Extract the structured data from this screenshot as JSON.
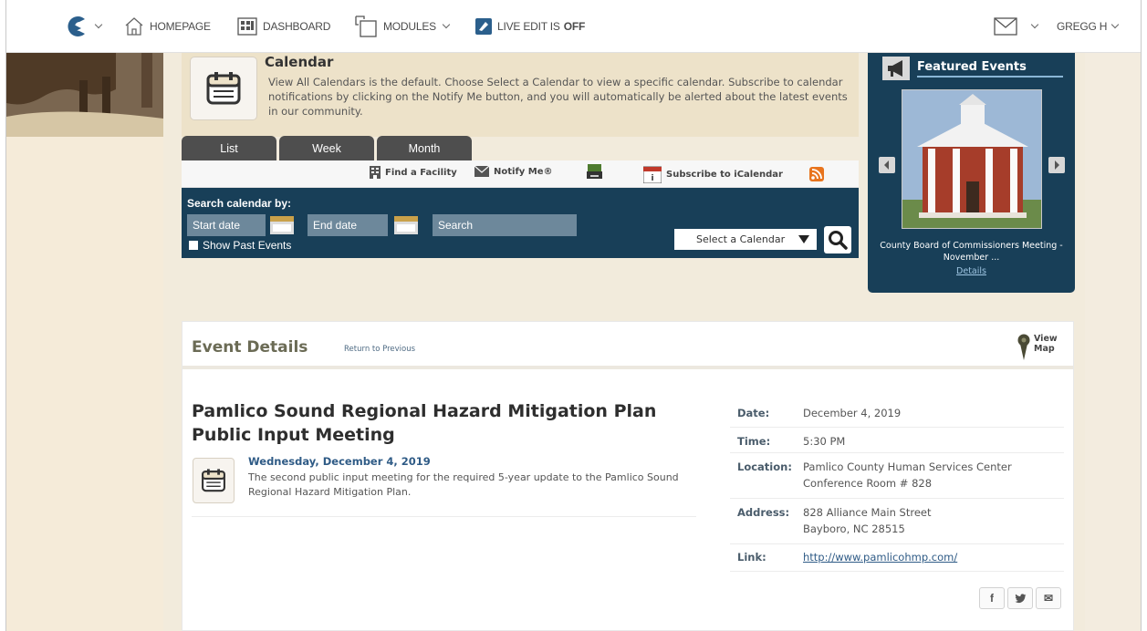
{
  "topbar": {
    "homepage": "HOMEPAGE",
    "dashboard": "DASHBOARD",
    "modules": "MODULES",
    "live_edit_prefix": "LIVE EDIT IS",
    "live_edit_state": "OFF",
    "user": "GREGG H"
  },
  "calendar": {
    "title": "Calendar",
    "description": "View All Calendars is the default. Choose Select a Calendar to view a specific calendar. Subscribe to calendar notifications by clicking on the Notify Me button, and you will automatically be alerted about the latest events in our community.",
    "tabs": [
      "List",
      "Week",
      "Month"
    ],
    "tools": {
      "find_facility": "Find a Facility",
      "notify_me": "Notify Me®",
      "subscribe": "Subscribe to iCalendar"
    },
    "search": {
      "label": "Search calendar by:",
      "start_placeholder": "Start date",
      "end_placeholder": "End date",
      "search_placeholder": "Search",
      "show_past": "Show Past Events",
      "select_calendar": "Select a Calendar"
    }
  },
  "featured": {
    "title": "Featured Events",
    "caption": "County Board of Commissioners Meeting - November ...",
    "details_link": "Details"
  },
  "event": {
    "section_title": "Event Details",
    "return_link": "Return to Previous",
    "view_map": "View Map",
    "title": "Pamlico Sound Regional Hazard Mitigation Plan Public Input Meeting",
    "date_heading": "Wednesday, December 4, 2019",
    "description": "The second public input meeting for the required 5-year update to the Pamlico Sound Regional Hazard Mitigation Plan.",
    "details": {
      "date_label": "Date:",
      "date": "December 4, 2019",
      "time_label": "Time:",
      "time": "5:30 PM",
      "location_label": "Location:",
      "location": "Pamlico County Human Services Center Conference Room # 828",
      "address_label": "Address:",
      "address": "828 Alliance Main Street Bayboro, NC 28515",
      "link_label": "Link:",
      "link": "http://www.pamlicohmp.com/"
    },
    "share": {
      "facebook": "f",
      "twitter": "t",
      "email": "✉"
    }
  }
}
